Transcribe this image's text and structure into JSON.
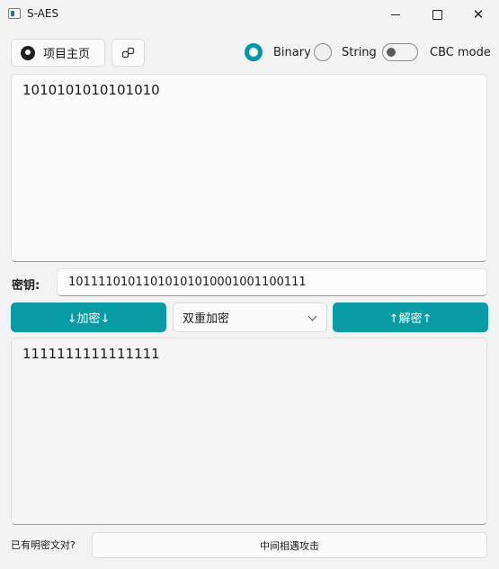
{
  "window": {
    "title": "S-AES"
  },
  "toolbar": {
    "home_label": "项目主页",
    "mode_binary": "Binary",
    "mode_string": "String",
    "mode_selected": "Binary",
    "cbc_label": "CBC mode",
    "cbc_enabled": false
  },
  "input": {
    "text": "1010101010101010"
  },
  "key": {
    "label": "密钥:",
    "value": "10111101011010101010001001100111"
  },
  "actions": {
    "encrypt_label": "↓加密↓",
    "decrypt_label": "↑解密↑",
    "mode_select_value": "双重加密"
  },
  "output": {
    "text": "1111111111111111"
  },
  "footer": {
    "known_pair_label": "已有明密文对?",
    "attack_label": "中间相遇攻击"
  },
  "colors": {
    "accent": "#0a9ca5",
    "radio_on": "#0097a7"
  },
  "icons": [
    "app-icon",
    "github-icon",
    "link-icon",
    "chevron-down-icon",
    "minimize-icon",
    "maximize-icon",
    "close-icon"
  ]
}
